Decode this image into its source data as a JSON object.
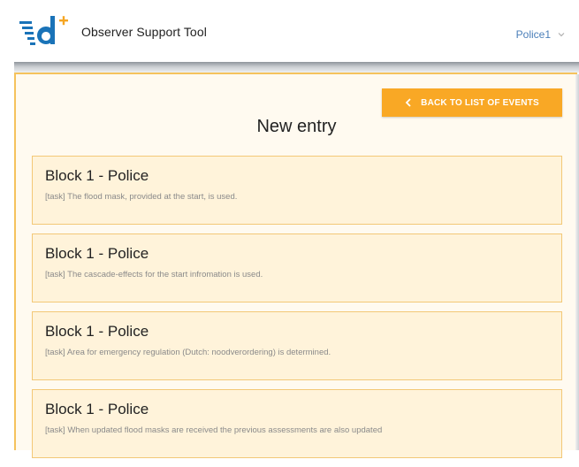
{
  "header": {
    "app_title": "Observer Support Tool",
    "user": "Police1",
    "colors": {
      "brand": "#1a73b8"
    },
    "icons": {
      "logo": "dplus-logo-icon",
      "user_menu": "chevron-down-icon"
    }
  },
  "main": {
    "back_button_label": "BACK TO LIST OF EVENTS",
    "back_icon": "chevron-left-icon",
    "page_title": "New entry",
    "accent_color": "#f9a825",
    "entries": [
      {
        "title": "Block 1 - Police",
        "task": "[task] The flood mask, provided at the start, is used."
      },
      {
        "title": "Block 1 - Police",
        "task": "[task] The cascade-effects for the start infromation is used."
      },
      {
        "title": "Block 1 - Police",
        "task": "[task] Area for emergency regulation (Dutch: noodverordering) is determined."
      },
      {
        "title": "Block 1 - Police",
        "task": "[task] When updated flood masks are received the previous assessments are also updated"
      }
    ]
  }
}
